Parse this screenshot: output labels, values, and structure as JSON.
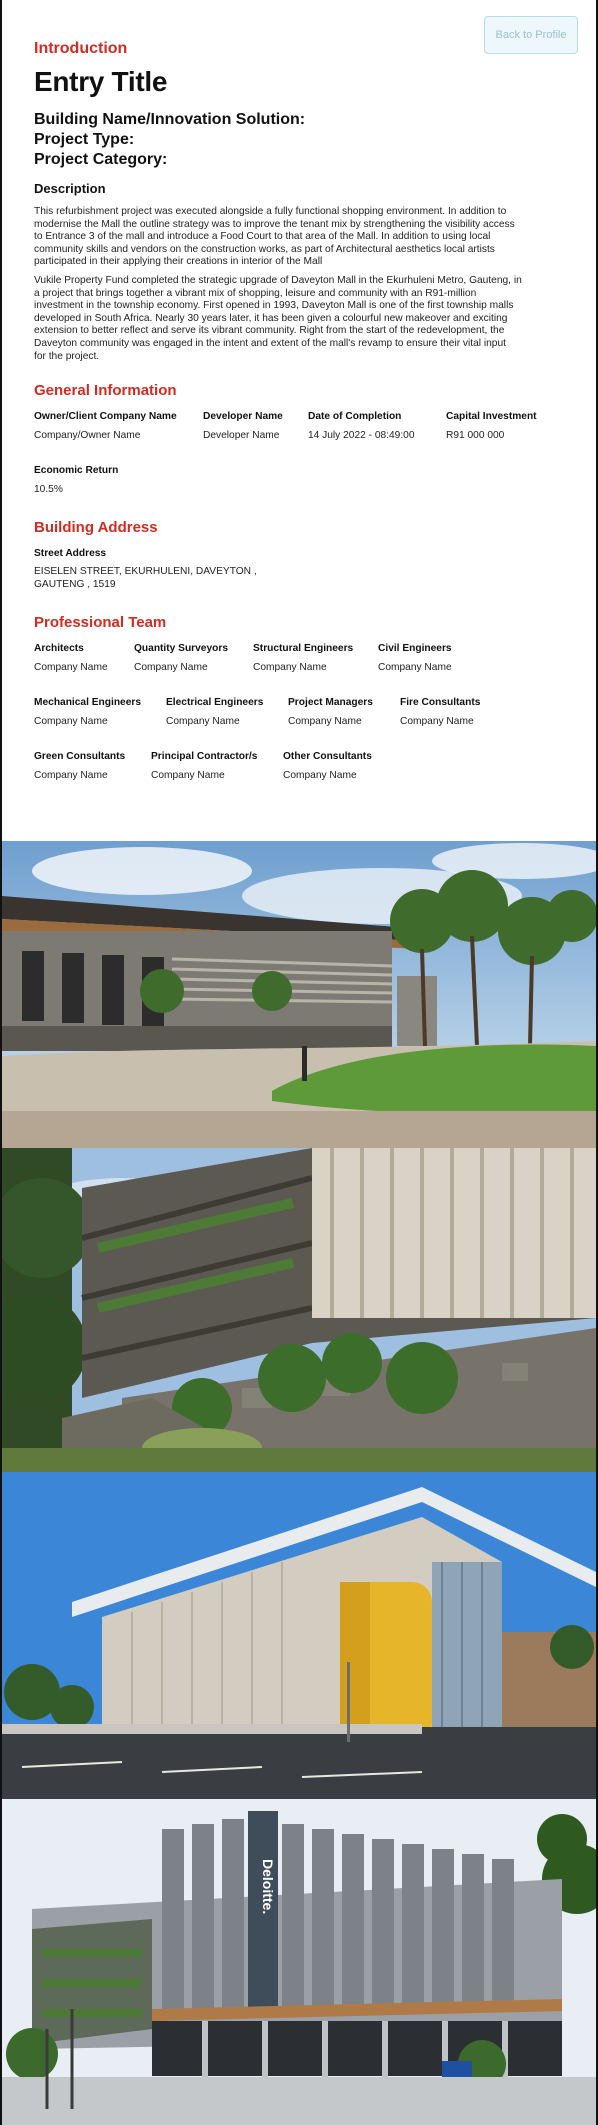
{
  "header": {
    "back_label": "Back to Profile",
    "intro_label": "Introduction",
    "entry_title": "Entry Title",
    "building_label": "Building Name/Innovation Solution:",
    "project_type_label": "Project Type:",
    "project_category_label": "Project Category:"
  },
  "description": {
    "heading": "Description",
    "para1_lines": [
      "This refurbishment project was executed alongside a fully functional shopping environment. In addition to",
      "modernise the Mall the outline strategy was to improve the tenant mix by strengthening the visibility access",
      "to Entrance 3 of the mall and introduce a Food Court to that area of the Mall. In addition to using local",
      "community skills and vendors on the construction works, as part of Architectural aesthetics local artists",
      "participated in their applying their creations in interior of the Mall"
    ],
    "para2_lines": [
      "Vukile Property Fund completed the strategic upgrade of Daveyton Mall in the Ekurhuleni Metro, Gauteng, in",
      "a project that brings together a vibrant mix of shopping, leisure and community with an R91-million",
      "investment in the township economy. First opened in 1993, Daveyton Mall is one of the first township malls",
      "developed in South Africa. Nearly 30 years later, it has been given a colourful new makeover and exciting",
      "extension to better reflect and serve its vibrant community. Right from the start of the redevelopment, the",
      "Daveyton community was engaged in the intent and extent of the mall's revamp to ensure their vital input",
      "for the project."
    ]
  },
  "general": {
    "title": "General Information",
    "owner_label": "Owner/Client Company Name",
    "owner_value": "Company/Owner Name",
    "developer_label": "Developer Name",
    "developer_value": "Developer Name",
    "completion_label": "Date of Completion",
    "completion_value": "14 July 2022 - 08:49:00",
    "investment_label": "Capital Investment",
    "investment_value": "R91 000 000",
    "return_label": "Economic Return",
    "return_value": "10.5%"
  },
  "address": {
    "title": "Building Address",
    "street_label": "Street Address",
    "street_line1": "EISELEN STREET, EKURHULENI, DAVEYTON ,",
    "street_line2": "GAUTENG , 1519"
  },
  "team": {
    "title": "Professional Team",
    "members": [
      {
        "role": "Architects",
        "name": "Company Name"
      },
      {
        "role": "Quantity Surveyors",
        "name": "Company Name"
      },
      {
        "role": "Structural Engineers",
        "name": "Company Name"
      },
      {
        "role": "Civil Engineers",
        "name": "Company Name"
      },
      {
        "role": "Mechanical Engineers",
        "name": "Company Name"
      },
      {
        "role": "Electrical Engineers",
        "name": "Company Name"
      },
      {
        "role": "Project Managers",
        "name": "Company Name"
      },
      {
        "role": "Fire Consultants",
        "name": "Company Name"
      },
      {
        "role": "Green Consultants",
        "name": "Company Name"
      },
      {
        "role": "Principal Contractor/s",
        "name": "Company Name"
      },
      {
        "role": "Other Consultants",
        "name": "Company Name"
      }
    ]
  },
  "gallery": {
    "photo4_sign_text": "Deloitte."
  },
  "colors": {
    "accent_red": "#d12c22",
    "button_border": "#b8dbe8"
  }
}
